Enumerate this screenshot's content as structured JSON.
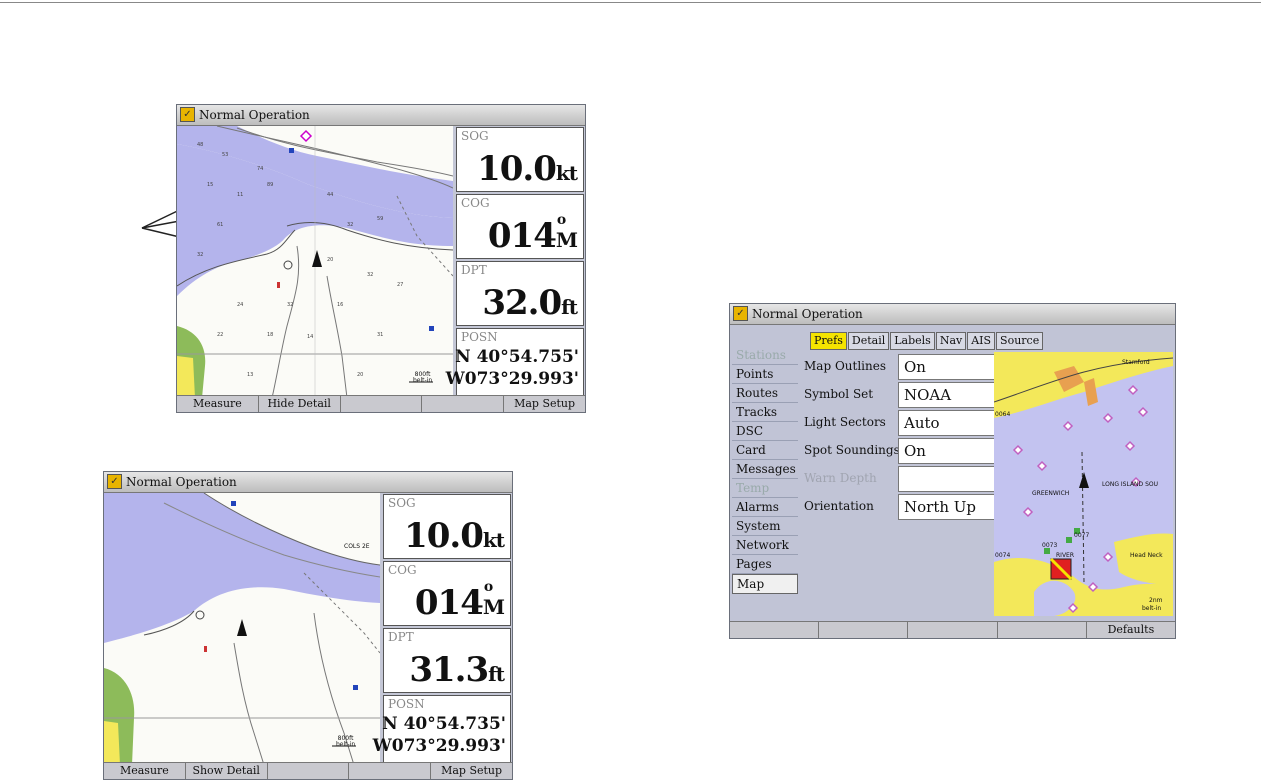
{
  "screen1": {
    "title": "Normal Operation",
    "sog": {
      "label": "SOG",
      "value": "10.0",
      "unit": "kt"
    },
    "cog": {
      "label": "COG",
      "value": "014",
      "unit_top": "o",
      "unit": "M"
    },
    "dpt": {
      "label": "DPT",
      "value": "32.0",
      "unit": "ft"
    },
    "posn": {
      "label": "POSN",
      "lat": "N  40°54.755'",
      "lon": "W073°29.993'"
    },
    "scale": {
      "value": "800ft",
      "sub": "belt-in"
    },
    "softkeys": [
      "Measure",
      "Hide Detail",
      "",
      "",
      "Map Setup"
    ]
  },
  "screen2": {
    "title": "Normal Operation",
    "sog": {
      "label": "SOG",
      "value": "10.0",
      "unit": "kt"
    },
    "cog": {
      "label": "COG",
      "value": "014",
      "unit_top": "o",
      "unit": "M"
    },
    "dpt": {
      "label": "DPT",
      "value": "31.3",
      "unit": "ft"
    },
    "posn": {
      "label": "POSN",
      "lat": "N  40°54.735'",
      "lon": "W073°29.993'"
    },
    "scale": {
      "value": "800ft",
      "sub": "belt-in"
    },
    "map_label": "COLS 2E",
    "softkeys": [
      "Measure",
      "Show Detail",
      "",
      "",
      "Map Setup"
    ]
  },
  "screen3": {
    "title": "Normal Operation",
    "sidebar": [
      {
        "label": "Stations",
        "state": "dim"
      },
      {
        "label": "Points",
        "state": "normal"
      },
      {
        "label": "Routes",
        "state": "normal"
      },
      {
        "label": "Tracks",
        "state": "normal"
      },
      {
        "label": "DSC",
        "state": "normal"
      },
      {
        "label": "Card",
        "state": "normal"
      },
      {
        "label": "Messages",
        "state": "normal"
      },
      {
        "label": "Temp",
        "state": "dim"
      },
      {
        "label": "Alarms",
        "state": "normal"
      },
      {
        "label": "System",
        "state": "normal"
      },
      {
        "label": "Network",
        "state": "normal"
      },
      {
        "label": "Pages",
        "state": "normal"
      },
      {
        "label": "Map",
        "state": "selected"
      }
    ],
    "tabs": [
      "Prefs",
      "Detail",
      "Labels",
      "Nav",
      "AIS",
      "Source"
    ],
    "settings": [
      {
        "label": "Map Outlines",
        "value": "On"
      },
      {
        "label": "Symbol Set",
        "value": "NOAA"
      },
      {
        "label": "Light Sectors",
        "value": "Auto"
      },
      {
        "label": "Spot Soundings",
        "value": "On"
      },
      {
        "label": "Warn Depth",
        "value": ""
      },
      {
        "label": "Orientation",
        "value": "North Up"
      }
    ],
    "map_labels": {
      "greenwich": "GREENWICH",
      "long_island": "LONG ISLAND SOU",
      "stamford": "Stamford",
      "pin1": "0077",
      "pin2": "0073",
      "pin3": "0074",
      "pin4": "0064",
      "river": "RIVER",
      "head": "Head Neck",
      "scale": "2nm",
      "scale_sub": "belt-in"
    },
    "softkeys": [
      "",
      "",
      "",
      "",
      "Defaults"
    ]
  },
  "colors": {
    "water": "#b4b4ec",
    "land": "#f3e85a",
    "green": "#8dbb5a",
    "highlight": "#f5e400"
  }
}
